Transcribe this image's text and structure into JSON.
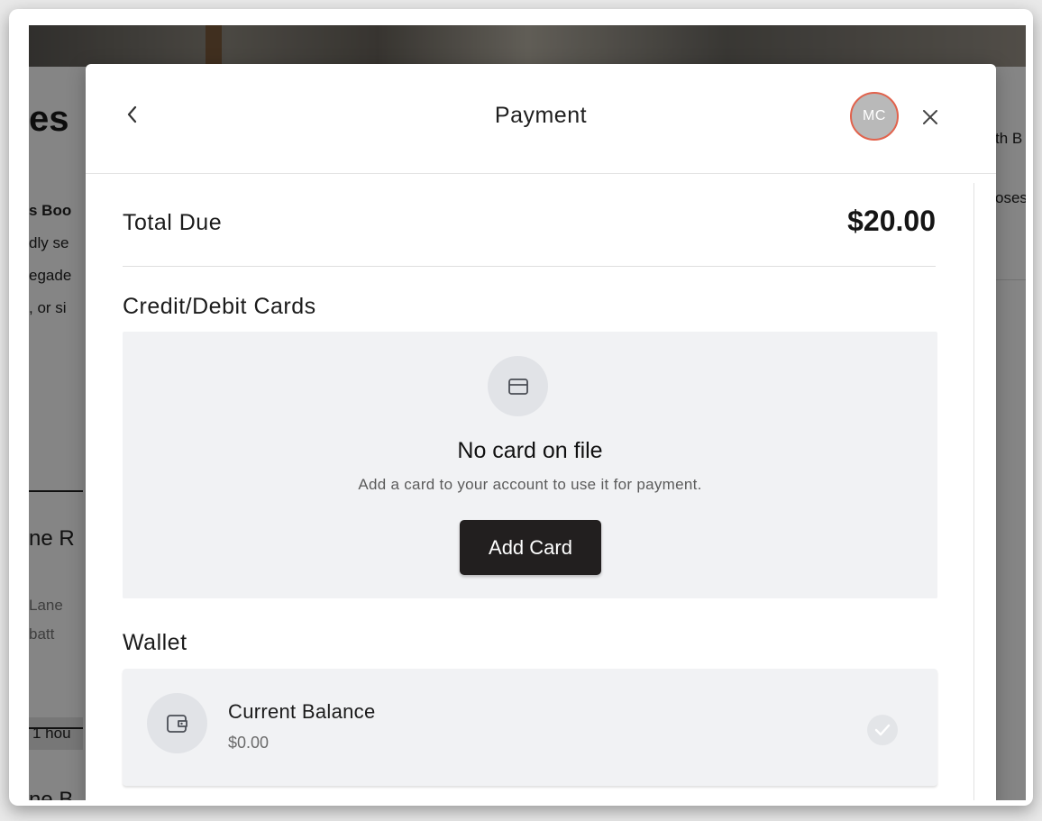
{
  "background": {
    "heading_fragment": "es",
    "left_lines": [
      "s Boo",
      "dly se",
      "egade",
      ", or si",
      "ne R",
      "Lane",
      "batt",
      "1 hou",
      "ne B"
    ],
    "right_lines": [
      "th B",
      "oses"
    ]
  },
  "modal": {
    "title": "Payment",
    "back_icon": "chevron-left-icon",
    "close_icon": "close-icon",
    "avatar_initials": "MC",
    "total": {
      "label": "Total Due",
      "amount": "$20.00"
    },
    "cards_section": {
      "title": "Credit/Debit Cards",
      "icon": "credit-card-icon",
      "empty_title": "No card on file",
      "empty_subtitle": "Add a card to your account to use it for payment.",
      "add_button_label": "Add Card"
    },
    "wallet_section": {
      "title": "Wallet",
      "icon": "wallet-icon",
      "balance_label": "Current Balance",
      "balance_value": "$0.00",
      "check_icon": "check-circle-icon"
    }
  },
  "colors": {
    "avatar_border": "#e1624c",
    "button_bg": "#221f1f",
    "panel_bg": "#f1f2f4"
  }
}
